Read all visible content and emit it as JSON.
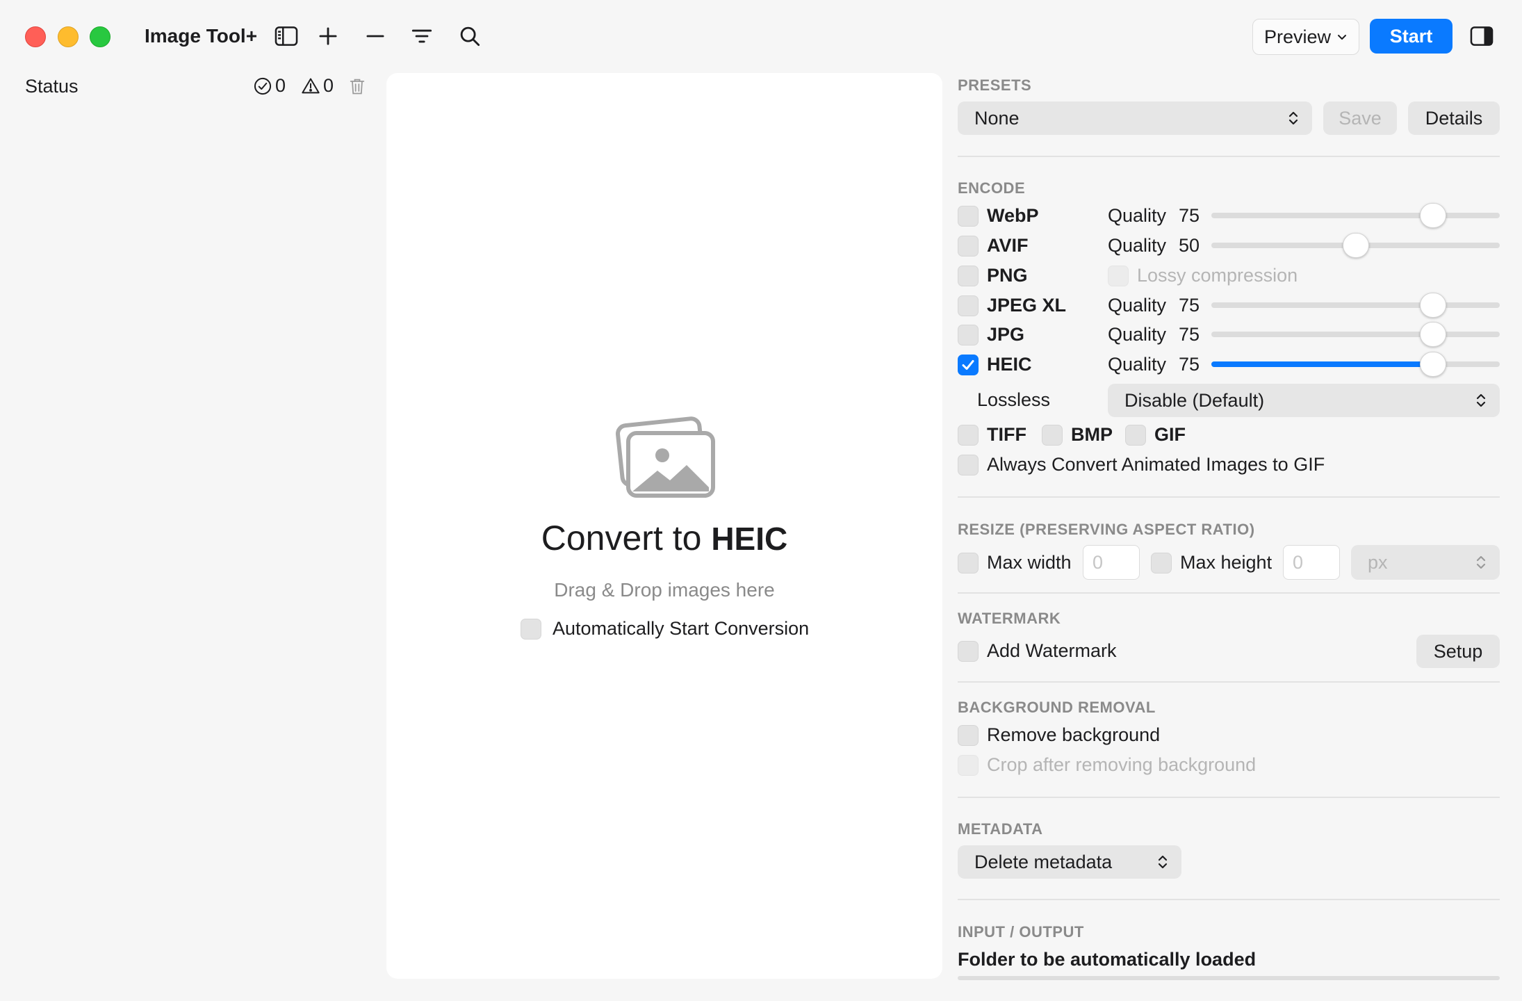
{
  "app": {
    "title": "Image Tool+"
  },
  "toolbar": {
    "icons": [
      "sidebar-icon",
      "plus-icon",
      "minus-icon",
      "filter-icon",
      "search-icon",
      "inspector-icon"
    ],
    "preview_label": "Preview",
    "start_label": "Start",
    "accent_color": "#0a7aff"
  },
  "status": {
    "label": "Status",
    "success_count": "0",
    "warning_count": "0"
  },
  "dropzone": {
    "title_prefix": "Convert to",
    "format": "HEIC",
    "subtitle": "Drag & Drop images here",
    "auto_start_label": "Automatically Start Conversion",
    "auto_start_checked": false
  },
  "presets": {
    "title": "PRESETS",
    "selected": "None",
    "save_label": "Save",
    "details_label": "Details"
  },
  "encode": {
    "title": "ENCODE",
    "quality_label": "Quality",
    "formats": [
      {
        "name": "WebP",
        "checked": false,
        "quality": 75,
        "quality_text": "75"
      },
      {
        "name": "AVIF",
        "checked": false,
        "quality": 50,
        "quality_text": "50"
      },
      {
        "name": "PNG",
        "checked": false,
        "option": "Lossy compression"
      },
      {
        "name": "JPEG XL",
        "checked": false,
        "quality": 75,
        "quality_text": "75"
      },
      {
        "name": "JPG",
        "checked": false,
        "quality": 75,
        "quality_text": "75"
      },
      {
        "name": "HEIC",
        "checked": true,
        "quality": 75,
        "quality_text": "75"
      }
    ],
    "lossless_label": "Lossless",
    "lossless_value": "Disable (Default)",
    "extra_formats": [
      "TIFF",
      "BMP",
      "GIF"
    ],
    "animated_gif_label": "Always Convert Animated Images to GIF"
  },
  "resize": {
    "title": "RESIZE (PRESERVING ASPECT RATIO)",
    "max_width_label": "Max width",
    "max_width_value": "0",
    "max_height_label": "Max height",
    "max_height_value": "0",
    "unit": "px"
  },
  "watermark": {
    "title": "WATERMARK",
    "add_label": "Add Watermark",
    "setup_label": "Setup"
  },
  "background": {
    "title": "BACKGROUND REMOVAL",
    "remove_label": "Remove background",
    "crop_label": "Crop after removing background"
  },
  "metadata": {
    "title": "METADATA",
    "selected": "Delete metadata"
  },
  "io": {
    "title": "INPUT / OUTPUT",
    "folder_label": "Folder to be automatically loaded"
  }
}
